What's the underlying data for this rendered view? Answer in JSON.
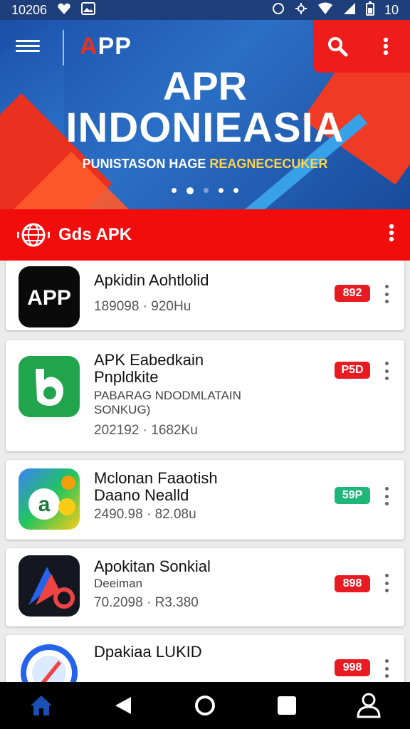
{
  "status_bar": {
    "time": "10206",
    "battery": "10"
  },
  "header": {
    "brand": "APP",
    "brand_accent_char": "A"
  },
  "hero": {
    "title_line1": "APR",
    "title_line2": "INDONIEASIA",
    "subtitle_part1": "PUNISTASON HAGE ",
    "subtitle_part2": "REAGNECECUKER",
    "carousel_dots": 5,
    "active_dot": 1
  },
  "section": {
    "title": "Gds APK"
  },
  "apps": [
    {
      "name": "Apkidin Aohtlolid",
      "desc": "",
      "meta": "189098 · 920Hu",
      "badge": "892",
      "badge_color": "#e81b23",
      "icon": "app-text-icon"
    },
    {
      "name": "APK Eabedkain\nPnpldkite",
      "desc": "PABARAG NDODMLATAIN\nSONKUG)",
      "meta": "202192 · 1682Ku",
      "badge": "P5D",
      "badge_color": "#e81b23",
      "icon": "green-b-icon"
    },
    {
      "name": "Mclonan Faaotish\nDaano Nealld",
      "desc": "",
      "meta": "2490.98 · 82.08u",
      "badge": "59P",
      "badge_color": "#1fb67a",
      "icon": "colorful-a-icon"
    },
    {
      "name": "Apokitan Sonkial",
      "desc": "Deeiman",
      "meta": "70.2098 · R3.380",
      "badge": "898",
      "badge_color": "#e81b23",
      "icon": "arrow-o-icon"
    },
    {
      "name": "Dpakiaa LUKID",
      "desc": "",
      "meta": "",
      "badge": "998",
      "badge_color": "#e81b23",
      "icon": "rocket-icon"
    }
  ],
  "colors": {
    "primary_red": "#f20d0d",
    "hero_blue": "#1b4fa8",
    "nav_active": "#1a4fb3"
  }
}
